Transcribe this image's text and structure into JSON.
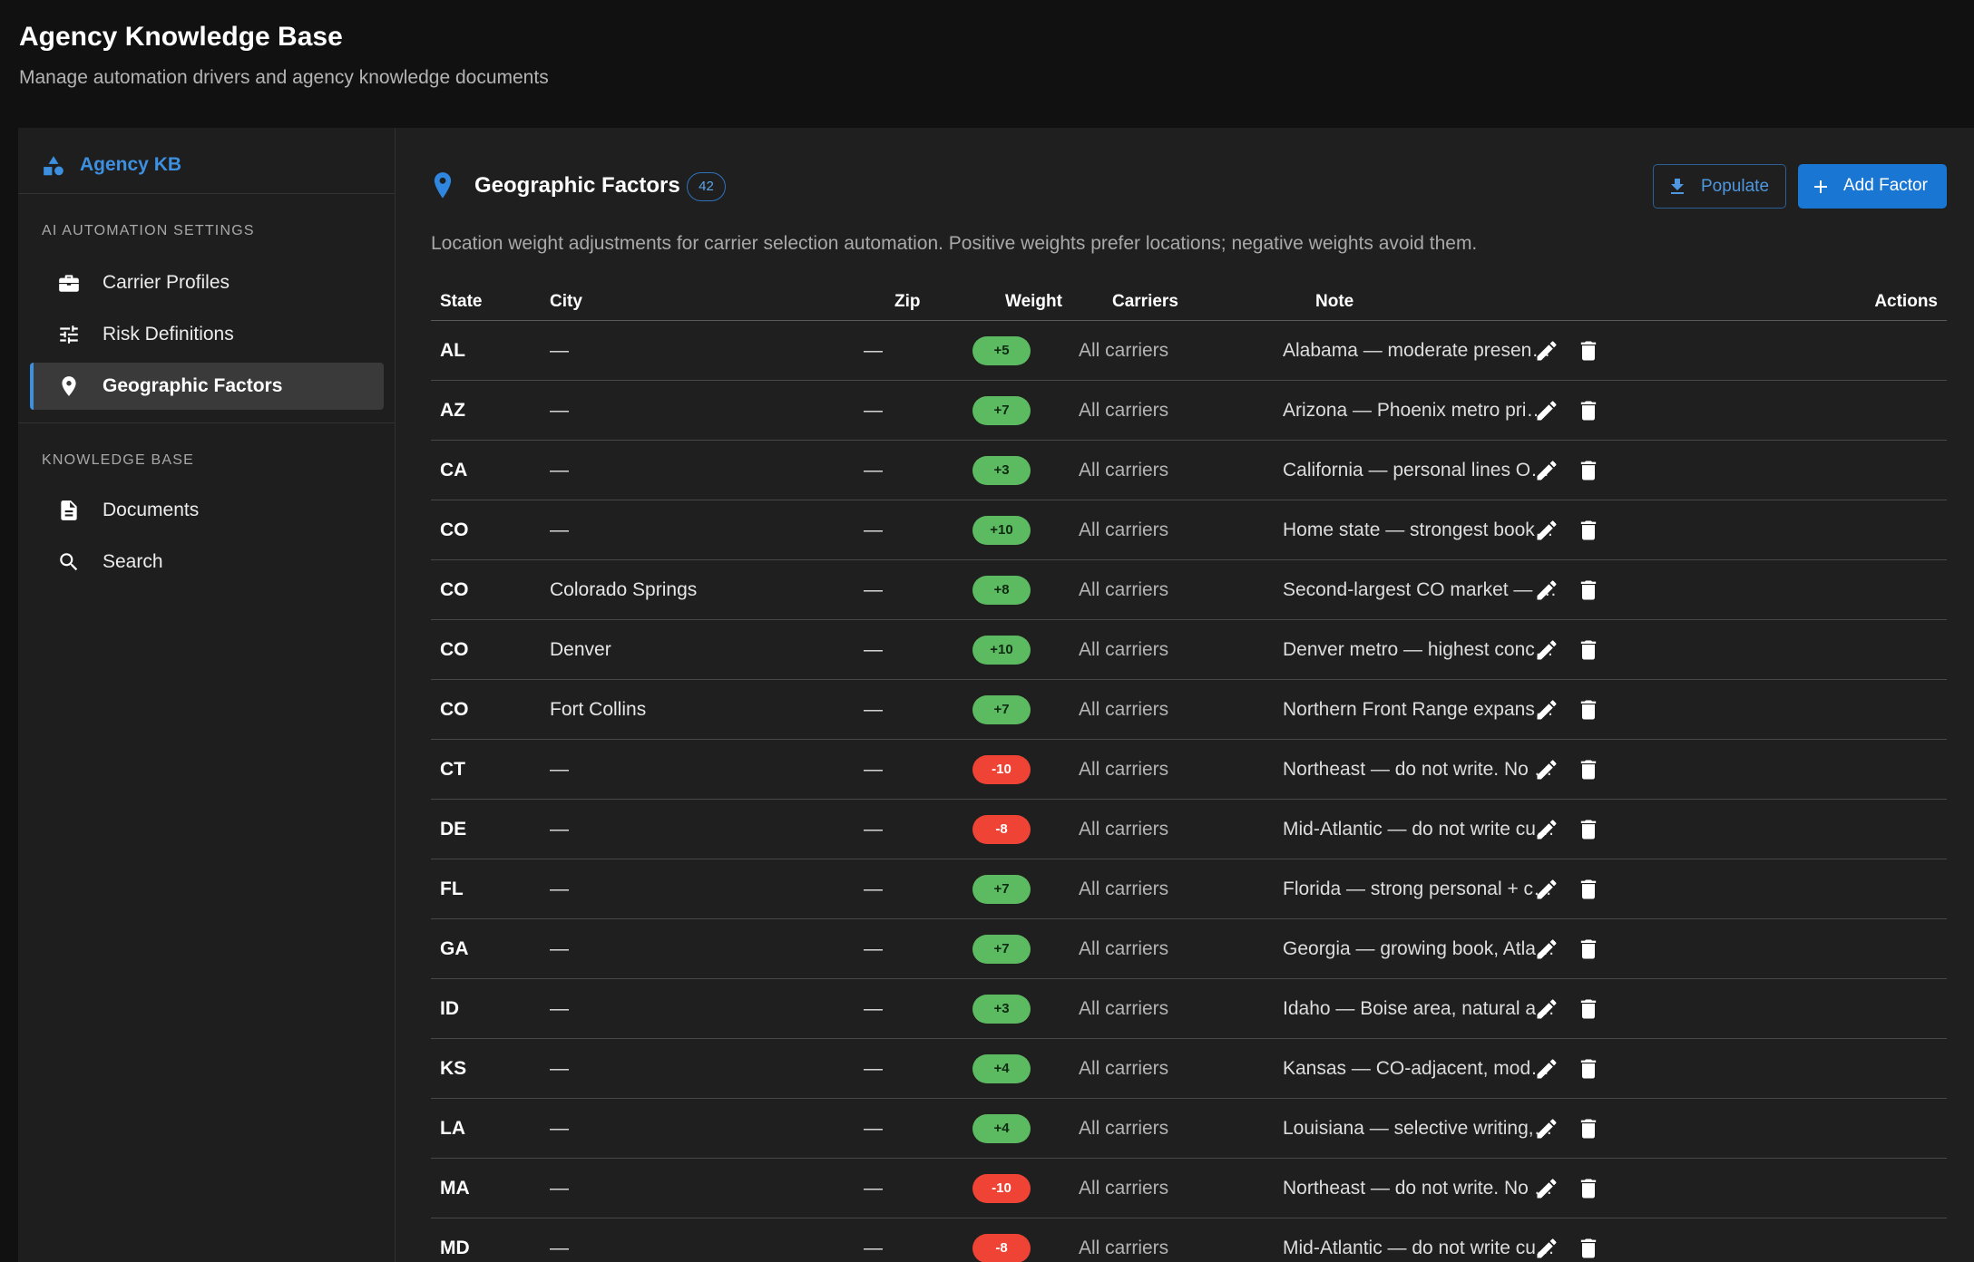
{
  "header": {
    "title": "Agency Knowledge Base",
    "subtitle": "Manage automation drivers and agency knowledge documents"
  },
  "sidebar": {
    "brand": "Agency KB",
    "section_ai": "AI AUTOMATION SETTINGS",
    "section_kb": "KNOWLEDGE BASE",
    "items": [
      {
        "label": "Carrier Profiles",
        "icon": "briefcase-icon"
      },
      {
        "label": "Risk Definitions",
        "icon": "tune-sliders-icon"
      },
      {
        "label": "Geographic Factors",
        "icon": "location-pin-icon",
        "active": true
      },
      {
        "label": "Documents",
        "icon": "document-icon"
      },
      {
        "label": "Search",
        "icon": "search-icon"
      }
    ]
  },
  "panel": {
    "title": "Geographic Factors",
    "count": "42",
    "populate_label": "Populate",
    "add_label": "Add Factor",
    "description": "Location weight adjustments for carrier selection automation. Positive weights prefer locations; negative weights avoid them."
  },
  "table": {
    "headers": {
      "state": "State",
      "city": "City",
      "zip": "Zip",
      "weight": "Weight",
      "carriers": "Carriers",
      "note": "Note",
      "actions": "Actions"
    },
    "rows": [
      {
        "state": "AL",
        "city": "—",
        "zip": "—",
        "weight": "+5",
        "carriers": "All carriers",
        "note": "Alabama — moderate presen…"
      },
      {
        "state": "AZ",
        "city": "—",
        "zip": "—",
        "weight": "+7",
        "carriers": "All carriers",
        "note": "Arizona — Phoenix metro pri…"
      },
      {
        "state": "CA",
        "city": "—",
        "zip": "—",
        "weight": "+3",
        "carriers": "All carriers",
        "note": "California — personal lines O…"
      },
      {
        "state": "CO",
        "city": "—",
        "zip": "—",
        "weight": "+10",
        "carriers": "All carriers",
        "note": "Home state — strongest book…"
      },
      {
        "state": "CO",
        "city": "Colorado Springs",
        "zip": "—",
        "weight": "+8",
        "carriers": "All carriers",
        "note": "Second-largest CO market — …"
      },
      {
        "state": "CO",
        "city": "Denver",
        "zip": "—",
        "weight": "+10",
        "carriers": "All carriers",
        "note": "Denver metro — highest conc…"
      },
      {
        "state": "CO",
        "city": "Fort Collins",
        "zip": "—",
        "weight": "+7",
        "carriers": "All carriers",
        "note": "Northern Front Range expans…"
      },
      {
        "state": "CT",
        "city": "—",
        "zip": "—",
        "weight": "-10",
        "carriers": "All carriers",
        "note": "Northeast — do not write. No …"
      },
      {
        "state": "DE",
        "city": "—",
        "zip": "—",
        "weight": "-8",
        "carriers": "All carriers",
        "note": "Mid-Atlantic — do not write cu…"
      },
      {
        "state": "FL",
        "city": "—",
        "zip": "—",
        "weight": "+7",
        "carriers": "All carriers",
        "note": "Florida — strong personal + c…"
      },
      {
        "state": "GA",
        "city": "—",
        "zip": "—",
        "weight": "+7",
        "carriers": "All carriers",
        "note": "Georgia — growing book, Atla…"
      },
      {
        "state": "ID",
        "city": "—",
        "zip": "—",
        "weight": "+3",
        "carriers": "All carriers",
        "note": "Idaho — Boise area, natural a…"
      },
      {
        "state": "KS",
        "city": "—",
        "zip": "—",
        "weight": "+4",
        "carriers": "All carriers",
        "note": "Kansas — CO-adjacent, mod…"
      },
      {
        "state": "LA",
        "city": "—",
        "zip": "—",
        "weight": "+4",
        "carriers": "All carriers",
        "note": "Louisiana — selective writing,…"
      },
      {
        "state": "MA",
        "city": "—",
        "zip": "—",
        "weight": "-10",
        "carriers": "All carriers",
        "note": "Northeast — do not write. No …"
      },
      {
        "state": "MD",
        "city": "—",
        "zip": "—",
        "weight": "-8",
        "carriers": "All carriers",
        "note": "Mid-Atlantic — do not write cu…"
      }
    ]
  },
  "colors": {
    "accent": "#1976d2",
    "positive": "#5cba60",
    "negative": "#ef4335"
  }
}
